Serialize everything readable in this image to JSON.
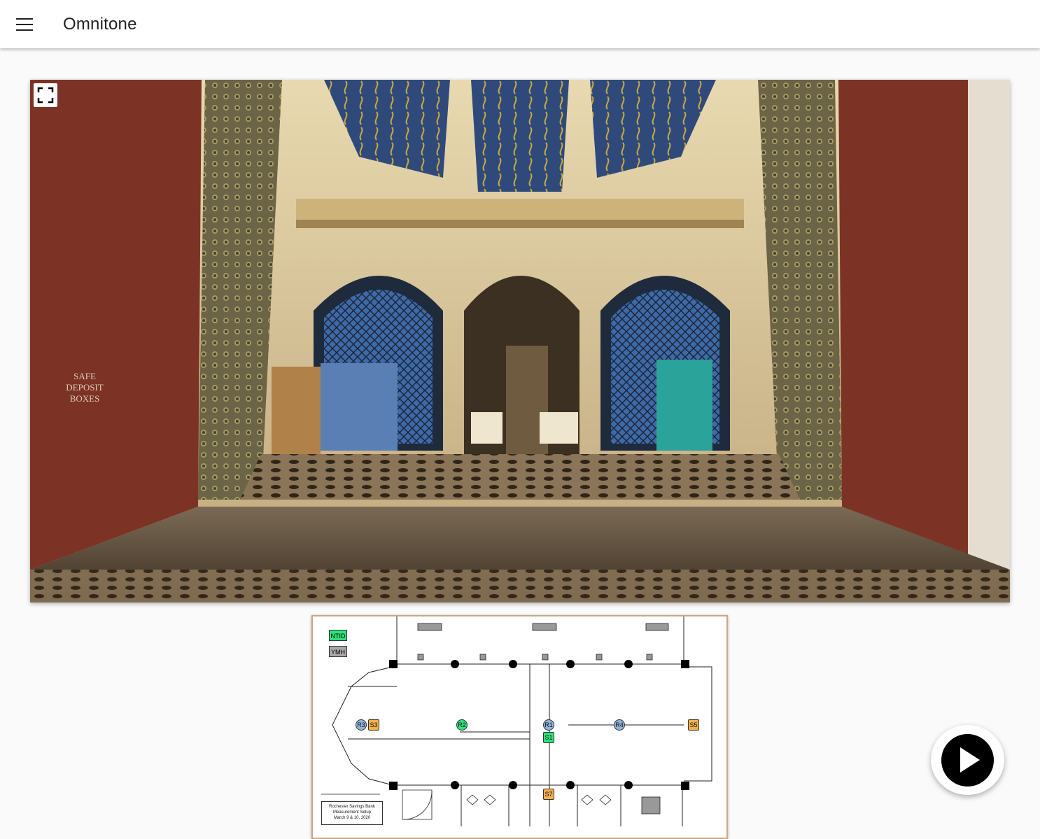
{
  "app": {
    "title": "Omnitone"
  },
  "icons": {
    "menu": "menu-icon",
    "fullscreen": "fullscreen-icon",
    "play": "play-icon"
  },
  "viewer": {
    "sign_text": [
      "SAFE",
      "DEPOSIT",
      "BOXES"
    ]
  },
  "floorplan": {
    "legend": [
      {
        "label": "NTID",
        "color": "#2ee37c"
      },
      {
        "label": "YMH",
        "color": "#a9a9a9"
      }
    ],
    "markers": [
      {
        "label": "R3",
        "kind": "circle",
        "color": "blue"
      },
      {
        "label": "S3",
        "kind": "square",
        "color": "orange"
      },
      {
        "label": "R2",
        "kind": "circle",
        "color": "green"
      },
      {
        "label": "R1",
        "kind": "circle",
        "color": "blue"
      },
      {
        "label": "S1",
        "kind": "square",
        "color": "green"
      },
      {
        "label": "R4",
        "kind": "circle",
        "color": "blue"
      },
      {
        "label": "S5",
        "kind": "square",
        "color": "orange"
      },
      {
        "label": "S7",
        "kind": "square",
        "color": "orange"
      }
    ],
    "caption": [
      "Rochester Savings Bank",
      "Measurement Setup",
      "March 9 & 10, 2020"
    ]
  }
}
